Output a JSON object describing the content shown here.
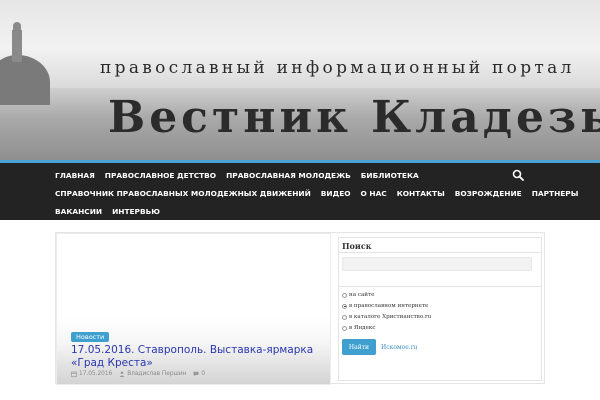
{
  "header": {
    "subtitle": "православный информационный портал",
    "title": "Вестник Кладезь"
  },
  "nav": {
    "row1": [
      "ГЛАВНАЯ",
      "ПРАВОСЛАВНОЕ ДЕТСТВО",
      "ПРАВОСЛАВНАЯ МОЛОДЕЖЬ",
      "БИБЛИОТЕКА"
    ],
    "row2": [
      "СПРАВОЧНИК ПРАВОСЛАВНЫХ МОЛОДЕЖНЫХ ДВИЖЕНИЙ",
      "ВИДЕО",
      "О НАС",
      "КОНТАКТЫ",
      "ВОЗРОЖДЕНИЕ",
      "ПАРТНЕРЫ"
    ],
    "row3": [
      "ВАКАНСИИ",
      "ИНТЕРВЬЮ"
    ],
    "search_icon": "search-icon"
  },
  "post": {
    "category": "Новости",
    "headline": "17.05.2016. Ставрополь. Выставка-ярмарка «Град Креста»",
    "date": "17.05.2016",
    "author": "Владислав Першин",
    "comments": "0"
  },
  "sidebar": {
    "title": "Поиск",
    "search_value": "",
    "options": [
      {
        "label": "на сайте",
        "selected": false
      },
      {
        "label": "в православном интернете",
        "selected": true
      },
      {
        "label": "в каталоге Христианство.ru",
        "selected": false
      },
      {
        "label": "в Яндекс",
        "selected": false
      }
    ],
    "button": "Найти",
    "link": "Искомое.ru"
  },
  "colors": {
    "accent": "#3fa0cf",
    "nav_bg": "#232323",
    "headline": "#2a36b0"
  }
}
